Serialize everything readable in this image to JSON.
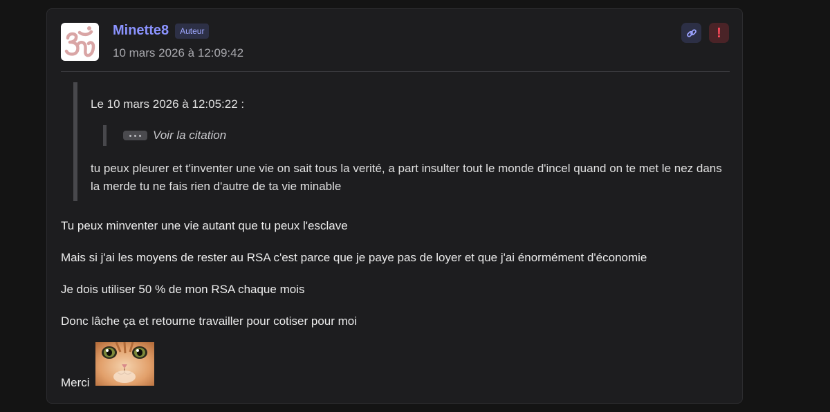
{
  "post": {
    "author": "Minette8",
    "badge": "Auteur",
    "date": "10 mars 2026 à 12:09:42",
    "avatar_icon": "om-symbol-icon",
    "actions": [
      {
        "icon": "link-icon"
      },
      {
        "icon": "report-icon",
        "glyph": "!"
      }
    ]
  },
  "quote": {
    "header": "Le 10 mars 2026 à 12:05:22 :",
    "nested_label": "Voir la citation",
    "text": "tu peux pleurer et t'inventer une vie on sait tous la verité, a part insulter tout le monde d'incel quand on te met le nez dans la merde tu ne fais rien d'autre de ta vie minable"
  },
  "body": {
    "paragraphs": [
      "Tu peux minventer une vie autant que tu peux l'esclave",
      "Mais si j'ai les moyens de rester au RSA c'est parce que je paye pas de loyer et que j'ai énormément d'économie",
      "Je dois utiliser 50 % de mon RSA chaque mois",
      "Donc lâche ça et retourne travailler pour cotiser pour moi"
    ],
    "closing": "Merci",
    "sticker_icon": "cat-face-sticker"
  },
  "colors": {
    "background": "#141414",
    "card": "#1d1d1f",
    "author": "#8b93ff",
    "report": "#ff4a5a",
    "avatar_symbol": "#d9a5a5"
  }
}
